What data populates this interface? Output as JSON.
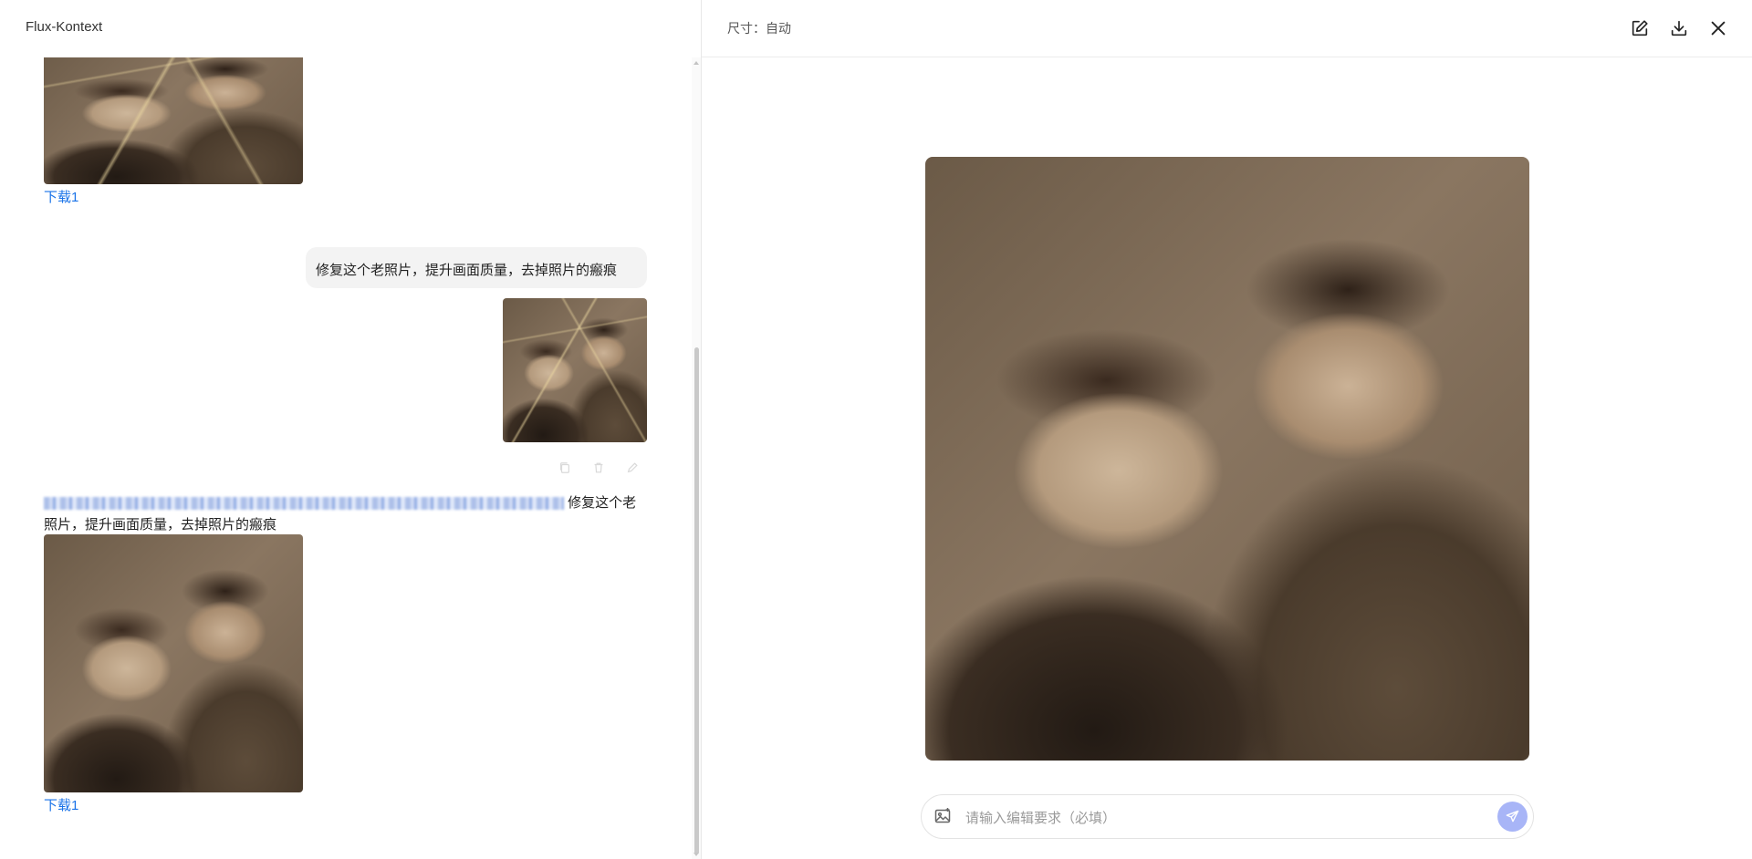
{
  "app": {
    "title": "Flux-Kontext"
  },
  "chat": {
    "messages": [
      {
        "role": "assistant",
        "download_label": "下载1"
      },
      {
        "role": "user",
        "text": "修复这个老照片，提升画面质量，去掉照片的瘢痕"
      },
      {
        "role": "assistant",
        "text_suffix_line1": "修复这个老",
        "text_line2": "照片，提升画面质量，去掉照片的瘢痕",
        "download_label": "下载1"
      }
    ],
    "bubble_actions": [
      "copy-icon",
      "delete-icon",
      "edit-icon"
    ]
  },
  "preview": {
    "size_label": "尺寸：自动",
    "header_icons": [
      "edit-icon",
      "download-icon",
      "close-icon"
    ],
    "input": {
      "placeholder": "请输入编辑要求（必填）",
      "value": ""
    },
    "colors": {
      "send_button": "#a8b5f7",
      "link": "#1a73e8"
    }
  }
}
